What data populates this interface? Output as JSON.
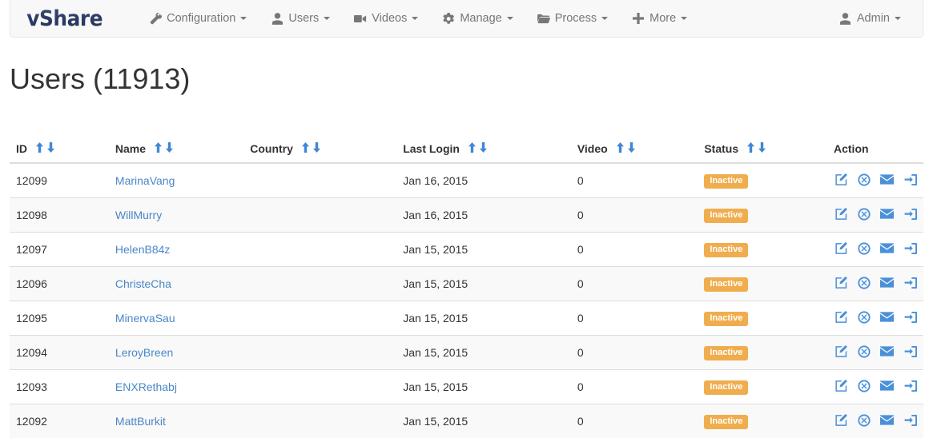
{
  "navbar": {
    "brand": "vShare",
    "items": [
      {
        "label": "Configuration",
        "icon": "wrench-icon",
        "caret": true
      },
      {
        "label": "Users",
        "icon": "user-icon",
        "caret": true
      },
      {
        "label": "Videos",
        "icon": "video-camera-icon",
        "caret": true
      },
      {
        "label": "Manage",
        "icon": "gear-icon",
        "caret": true
      },
      {
        "label": "Process",
        "icon": "folder-open-icon",
        "caret": true
      },
      {
        "label": "More",
        "icon": "plus-icon",
        "caret": true
      }
    ],
    "account": {
      "label": "Admin",
      "icon": "user-icon",
      "caret": true
    }
  },
  "page": {
    "title": "Users (11913)",
    "count": 11913
  },
  "table": {
    "columns": [
      {
        "key": "id",
        "label": "ID",
        "sortable": true
      },
      {
        "key": "name",
        "label": "Name",
        "sortable": true
      },
      {
        "key": "country",
        "label": "Country",
        "sortable": true
      },
      {
        "key": "login",
        "label": "Last Login",
        "sortable": true
      },
      {
        "key": "video",
        "label": "Video",
        "sortable": true
      },
      {
        "key": "status",
        "label": "Status",
        "sortable": true
      },
      {
        "key": "action",
        "label": "Action",
        "sortable": false
      }
    ],
    "sort_asc_icon": "arrow-up-icon",
    "sort_desc_icon": "arrow-down-icon",
    "row_actions": [
      {
        "name": "edit-icon",
        "title": "Edit"
      },
      {
        "name": "ban-icon",
        "title": "Ban"
      },
      {
        "name": "envelope-icon",
        "title": "Send mail"
      },
      {
        "name": "sign-in-icon",
        "title": "Login as user"
      }
    ],
    "status_color": "#f0ad4e",
    "link_color": "#4a87c8",
    "rows": [
      {
        "id": "12099",
        "name": "MarinaVang",
        "country": "",
        "login": "Jan 16, 2015",
        "video": "0",
        "status": "Inactive"
      },
      {
        "id": "12098",
        "name": "WillMurry",
        "country": "",
        "login": "Jan 16, 2015",
        "video": "0",
        "status": "Inactive"
      },
      {
        "id": "12097",
        "name": "HelenB84z",
        "country": "",
        "login": "Jan 15, 2015",
        "video": "0",
        "status": "Inactive"
      },
      {
        "id": "12096",
        "name": "ChristeCha",
        "country": "",
        "login": "Jan 15, 2015",
        "video": "0",
        "status": "Inactive"
      },
      {
        "id": "12095",
        "name": "MinervaSau",
        "country": "",
        "login": "Jan 15, 2015",
        "video": "0",
        "status": "Inactive"
      },
      {
        "id": "12094",
        "name": "LeroyBreen",
        "country": "",
        "login": "Jan 15, 2015",
        "video": "0",
        "status": "Inactive"
      },
      {
        "id": "12093",
        "name": "ENXRethabj",
        "country": "",
        "login": "Jan 15, 2015",
        "video": "0",
        "status": "Inactive"
      },
      {
        "id": "12092",
        "name": "MattBurkit",
        "country": "",
        "login": "Jan 15, 2015",
        "video": "0",
        "status": "Inactive"
      }
    ]
  }
}
